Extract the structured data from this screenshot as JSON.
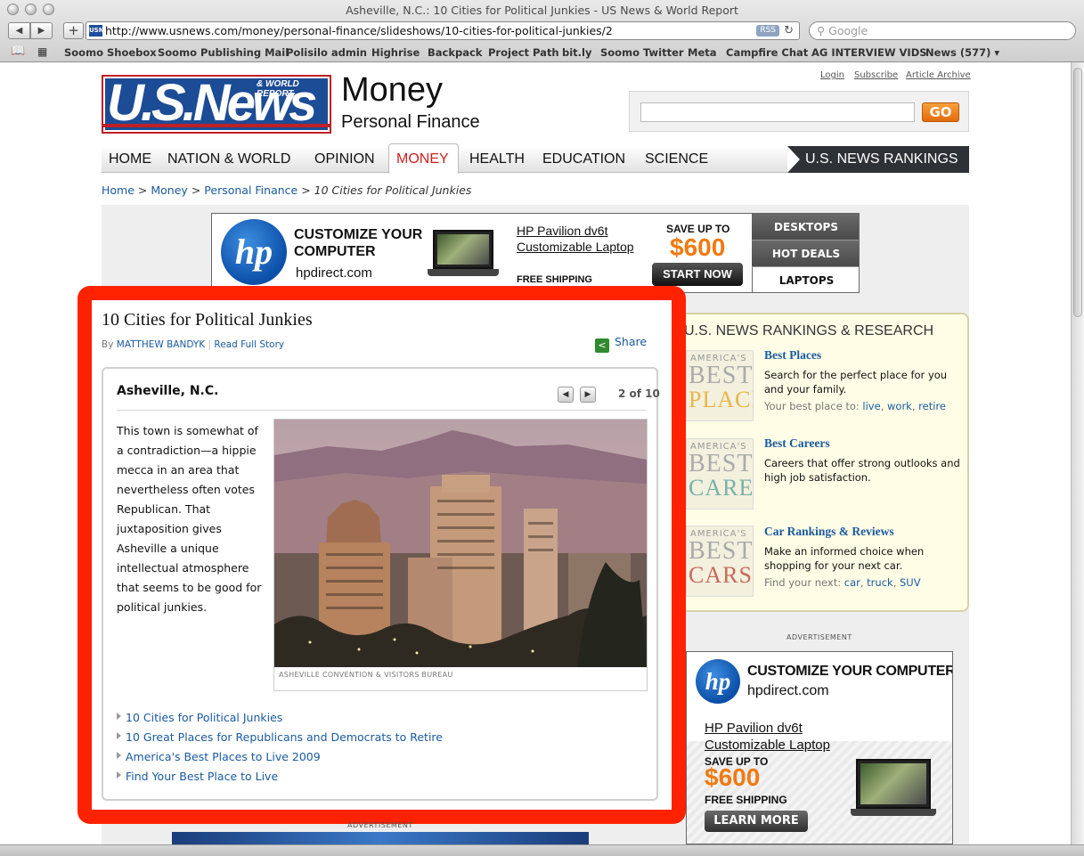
{
  "browser": {
    "window_title": "Asheville, N.C.: 10 Cities for Political Junkies - US News & World Report",
    "url": "http://www.usnews.com/money/personal-finance/slideshows/10-cities-for-political-junkies/2",
    "favicon_text": "USN",
    "rss_label": "RSS",
    "search_placeholder": "Google",
    "bookmarks": [
      "Soomo Shoebox",
      "Soomo Publishing Mail",
      "Polisilo admin",
      "Highrise",
      "Backpack",
      "Project Path",
      "bit.ly",
      "Soomo Twitter",
      "Meta",
      "Campfire Chat",
      "AG INTERVIEW VIDS",
      "News (577) ▾"
    ]
  },
  "site": {
    "toplinks": [
      "Login",
      "Subscribe",
      "Article Archive"
    ],
    "logo_main": "U.S.News",
    "logo_sub": "& WORLD REPORT",
    "section_title": "Money",
    "section_subtitle": "Personal Finance",
    "go_label": "GO",
    "nav": [
      "HOME",
      "NATION & WORLD",
      "OPINION",
      "MONEY",
      "HEALTH",
      "EDUCATION",
      "SCIENCE"
    ],
    "nav_active": "MONEY",
    "rankings_tab": "U.S. NEWS RANKINGS",
    "active_color": "#cc1f1f"
  },
  "breadcrumb": {
    "items": [
      "Home",
      "Money",
      "Personal Finance"
    ],
    "sep": ">",
    "current": "10 Cities for Political Junkies"
  },
  "top_ad": {
    "headline": "CUSTOMIZE YOUR\nCOMPUTER",
    "domain": "hpdirect.com",
    "product": "HP Pavilion dv6t\nCustomizable Laptop",
    "shipping": "FREE SHIPPING",
    "save_label": "SAVE UP TO",
    "save_amount": "$600",
    "cta": "START NOW",
    "menu": [
      "DESKTOPS",
      "HOT DEALS",
      "LAPTOPS"
    ]
  },
  "article": {
    "title": "10 Cities for Political Junkies",
    "by_label": "By",
    "author": "MATTHEW BANDYK",
    "separator": "|",
    "read_full": "Read Full Story",
    "share_label": "Share",
    "slide": {
      "city": "Asheville, N.C.",
      "counter": "2 of 10",
      "text": "This town is somewhat of a contradiction—a hippie mecca in an area that nevertheless often votes Republican. That juxtaposition gives Asheville a unique intellectual atmosphere that seems to be good for political junkies.",
      "photo_credit": "ASHEVILLE CONVENTION & VISITORS BUREAU"
    },
    "related": [
      "10 Cities for Political Junkies",
      "10 Great Places for Republicans and Democrats to Retire",
      "America's Best Places to Live 2009",
      "Find Your Best Place to Live"
    ]
  },
  "rankings": {
    "heading": "U.S. NEWS RANKINGS & RESEARCH",
    "items": [
      {
        "thumb_small": "AMERICA'S",
        "thumb_big": "BEST",
        "thumb_word": "PLACES",
        "thumb_color": "#e8b64a",
        "title": "Best Places",
        "desc": "Search for the perfect place for you and your family.",
        "links_prefix": "Your best place to:",
        "links": [
          "live",
          "work",
          "retire"
        ]
      },
      {
        "thumb_small": "AMERICA'S",
        "thumb_big": "BEST",
        "thumb_word": "CAREERS",
        "thumb_color": "#7ab0a8",
        "title": "Best Careers",
        "desc": "Careers that offer strong outlooks and high job satisfaction.",
        "links_prefix": "",
        "links": []
      },
      {
        "thumb_small": "AMERICA'S",
        "thumb_big": "BEST",
        "thumb_word": "CARS",
        "thumb_color": "#c66a5c",
        "title": "Car Rankings & Reviews",
        "desc": "Make an informed choice when shopping for your next car.",
        "links_prefix": "Find your next:",
        "links": [
          "car",
          "truck",
          "SUV"
        ]
      }
    ]
  },
  "side_ad": {
    "label": "ADVERTISEMENT",
    "headline": "CUSTOMIZE YOUR COMPUTER",
    "domain": "hpdirect.com",
    "product": "HP Pavilion dv6t\nCustomizable Laptop",
    "save_label": "SAVE UP TO",
    "save_amount": "$600",
    "shipping": "FREE SHIPPING",
    "cta": "LEARN MORE"
  },
  "bottom_ad": {
    "label": "ADVERTISEMENT"
  },
  "hp_logo_text": "hp",
  "accent_orange": "#f07a12",
  "highlight_red": "#ff2200"
}
